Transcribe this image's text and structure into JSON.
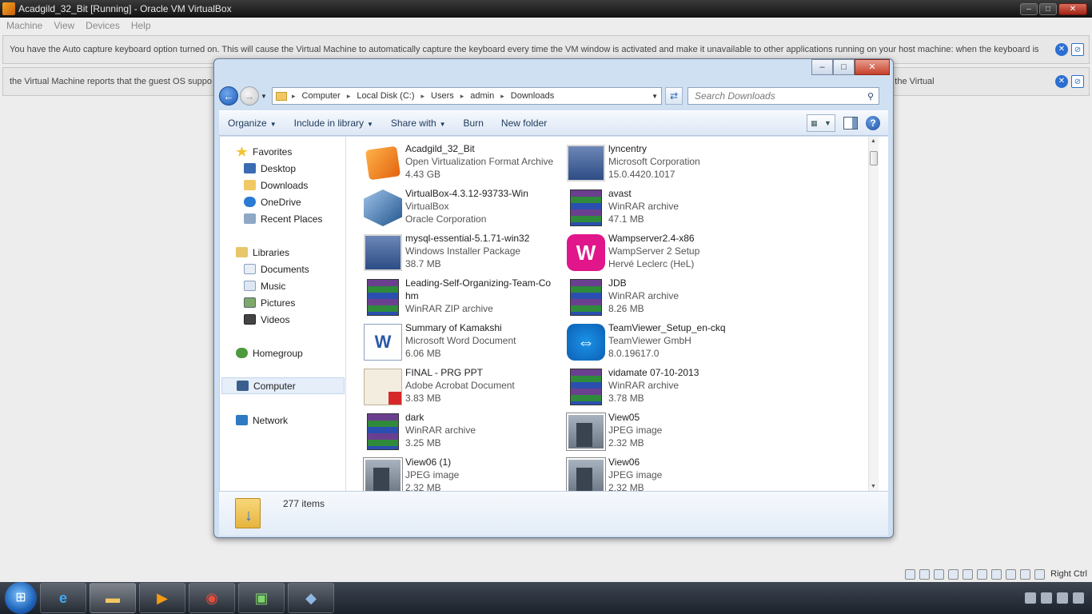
{
  "vbox": {
    "title": "Acadgild_32_Bit [Running] - Oracle VM VirtualBox",
    "menu": [
      "Machine",
      "View",
      "Devices",
      "Help"
    ],
    "notice1": "You have the Auto capture keyboard option turned on. This will cause the Virtual Machine to automatically capture the keyboard every time the VM window is activated and make it unavailable to other applications running on your host machine: when the keyboard is",
    "notice2": "the Virtual Machine reports that the guest OS suppo",
    "notice2_tail": "mouse pointer is over the Virtual",
    "status_hostkey": "Right Ctrl"
  },
  "explorer": {
    "breadcrumb": [
      "Computer",
      "Local Disk (C:)",
      "Users",
      "admin",
      "Downloads"
    ],
    "search_placeholder": "Search Downloads",
    "toolbar": {
      "organize": "Organize",
      "include": "Include in library",
      "share": "Share with",
      "burn": "Burn",
      "new_folder": "New folder"
    },
    "nav": {
      "favorites": "Favorites",
      "desktop": "Desktop",
      "downloads": "Downloads",
      "onedrive": "OneDrive",
      "recent": "Recent Places",
      "libraries": "Libraries",
      "documents": "Documents",
      "music": "Music",
      "pictures": "Pictures",
      "videos": "Videos",
      "homegroup": "Homegroup",
      "computer": "Computer",
      "network": "Network"
    },
    "files": [
      {
        "name": "Acadgild_32_Bit",
        "line2": "Open Virtualization Format Archive",
        "line3": "4.43 GB",
        "icon": "ova-icon"
      },
      {
        "name": "lyncentry",
        "line2": "Microsoft Corporation",
        "line3": "15.0.4420.1017",
        "icon": "installer-icon"
      },
      {
        "name": "VirtualBox-4.3.12-93733-Win",
        "line2": "VirtualBox",
        "line3": "Oracle Corporation",
        "icon": "virtualbox-icon"
      },
      {
        "name": "avast",
        "line2": "WinRAR archive",
        "line3": "47.1 MB",
        "icon": "winrar-icon"
      },
      {
        "name": "mysql-essential-5.1.71-win32",
        "line2": "Windows Installer Package",
        "line3": "38.7 MB",
        "icon": "msi-icon"
      },
      {
        "name": "Wampserver2.4-x86",
        "line2": "WampServer 2 Setup",
        "line3": "Hervé Leclerc (HeL)",
        "icon": "wamp-icon"
      },
      {
        "name": "Leading-Self-Organizing-Team-Co",
        "name2": "hm",
        "line3": "WinRAR ZIP archive",
        "icon": "winrar-icon"
      },
      {
        "name": "JDB",
        "line2": "WinRAR archive",
        "line3": "8.26 MB",
        "icon": "winrar-icon"
      },
      {
        "name": "Summary of Kamakshi",
        "line2": "Microsoft Word Document",
        "line3": "6.06 MB",
        "icon": "word-icon"
      },
      {
        "name": "TeamViewer_Setup_en-ckq",
        "line2": "TeamViewer GmbH",
        "line3": "8.0.19617.0",
        "icon": "teamviewer-icon"
      },
      {
        "name": "FINAL - PRG PPT",
        "line2": "Adobe Acrobat Document",
        "line3": "3.83 MB",
        "icon": "pdf-icon"
      },
      {
        "name": "vidamate 07-10-2013",
        "line2": "WinRAR archive",
        "line3": "3.78 MB",
        "icon": "winrar-icon"
      },
      {
        "name": "dark",
        "line2": "WinRAR archive",
        "line3": "3.25 MB",
        "icon": "winrar-icon"
      },
      {
        "name": "View05",
        "line2": "JPEG image",
        "line3": "2.32 MB",
        "icon": "jpeg-icon"
      },
      {
        "name": "View06 (1)",
        "line2": "JPEG image",
        "line3": "2.32 MB",
        "icon": "jpeg-icon"
      },
      {
        "name": "View06",
        "line2": "JPEG image",
        "line3": "2.32 MB",
        "icon": "jpeg-icon"
      }
    ],
    "item_count": "277 items"
  }
}
